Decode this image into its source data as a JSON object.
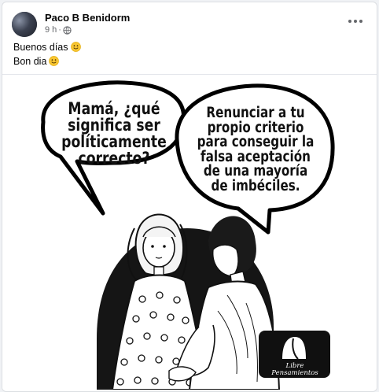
{
  "post": {
    "author": "Paco B Benidorm",
    "time": "9 h",
    "separator": "·",
    "audience_icon": "globe-icon",
    "menu_icon": "more-options-icon",
    "lines": [
      "Buenos días",
      "Bon dia"
    ],
    "line_emoji": "smile-emoji"
  },
  "image": {
    "bubble_left": [
      "Mamá, ¿qué",
      "significa ser",
      "políticamente",
      "correcto?"
    ],
    "bubble_right": [
      "Renunciar a tu",
      "propio criterio",
      "para conseguir la",
      "falsa aceptación",
      "de una mayoría",
      "de imbéciles."
    ],
    "logo_lines": [
      "Libre",
      "Pensamientos"
    ]
  }
}
